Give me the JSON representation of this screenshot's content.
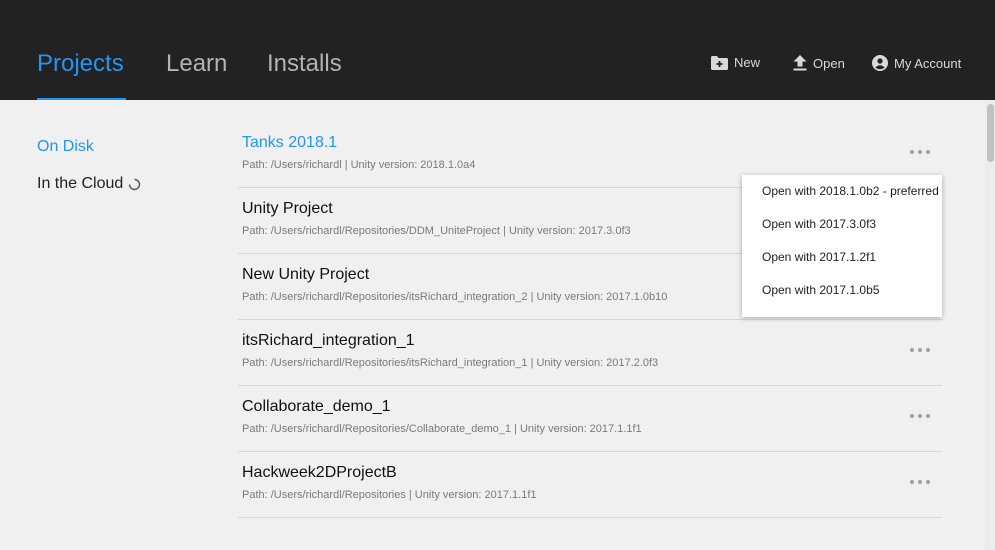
{
  "header": {
    "tabs": [
      {
        "label": "Projects",
        "active": true
      },
      {
        "label": "Learn",
        "active": false
      },
      {
        "label": "Installs",
        "active": false
      }
    ],
    "actions": {
      "new_label": "New",
      "open_label": "Open",
      "account_label": "My Account"
    }
  },
  "sidebar": {
    "items": [
      {
        "label": "On Disk",
        "active": true
      },
      {
        "label": "In the Cloud",
        "active": false,
        "loading": true
      }
    ]
  },
  "projects": [
    {
      "name": "Tanks 2018.1",
      "path": "Path: /Users/richardl | Unity version: 2018.1.0a4"
    },
    {
      "name": "Unity Project",
      "path": "Path: /Users/richardl/Repositories/DDM_UniteProject | Unity version: 2017.3.0f3"
    },
    {
      "name": "New Unity Project",
      "path": "Path: /Users/richardl/Repositories/itsRichard_integration_2 | Unity version: 2017.1.0b10"
    },
    {
      "name": "itsRichard_integration_1",
      "path": "Path: /Users/richardl/Repositories/itsRichard_integration_1 | Unity version: 2017.2.0f3"
    },
    {
      "name": "Collaborate_demo_1",
      "path": "Path: /Users/richardl/Repositories/Collaborate_demo_1 | Unity version: 2017.1.1f1"
    },
    {
      "name": "Hackweek2DProjectB",
      "path": "Path: /Users/richardl/Repositories | Unity version: 2017.1.1f1"
    }
  ],
  "dropdown": {
    "options": [
      "Open with 2018.1.0b2 - preferred",
      "Open with 2017.3.0f3",
      "Open with 2017.1.2f1",
      "Open with 2017.1.0b5"
    ]
  },
  "colors": {
    "accent": "#2196f3",
    "header_bg": "#222222",
    "page_bg": "#f0f0f0"
  }
}
